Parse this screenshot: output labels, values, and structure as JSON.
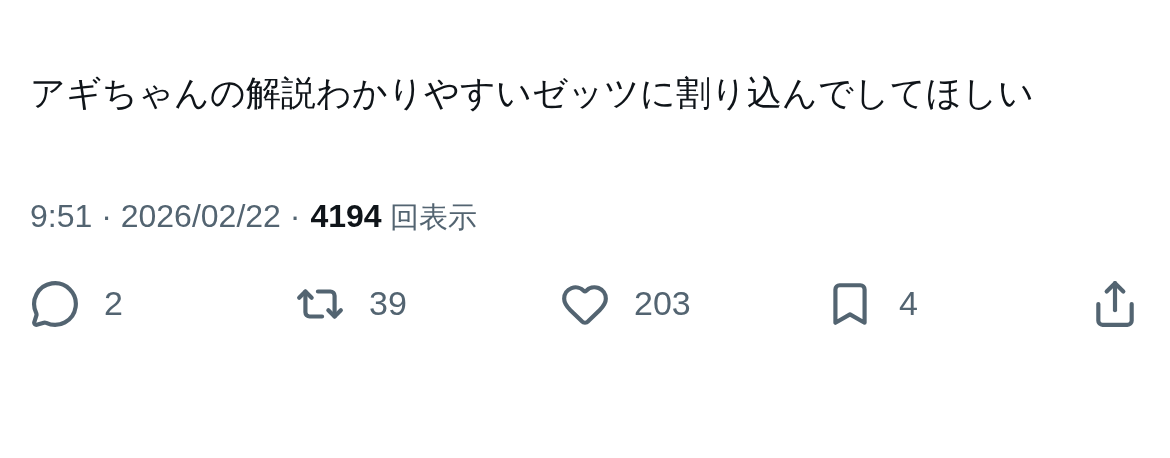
{
  "post": {
    "text": "アギちゃんの解説わかりやすいゼッツに割り込んでしてほしい",
    "timestamp": "9:51 · 2026/02/22 ·",
    "views": "4194",
    "views_label": "回表示"
  },
  "actions": [
    {
      "kind": "reply",
      "count": "2"
    },
    {
      "kind": "repost",
      "count": "39"
    },
    {
      "kind": "like",
      "count": "203"
    },
    {
      "kind": "bookmark",
      "count": "4"
    },
    {
      "kind": "share"
    }
  ]
}
